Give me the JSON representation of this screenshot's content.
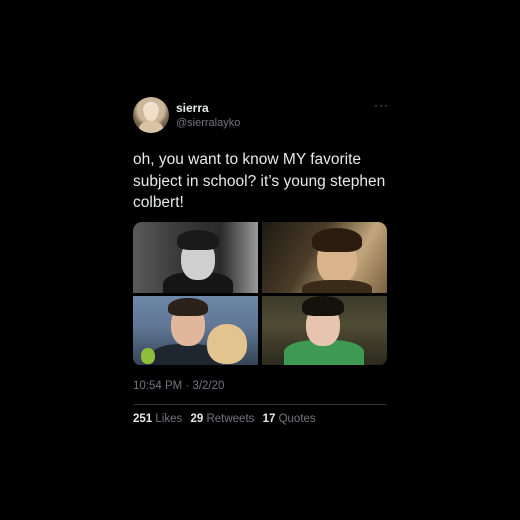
{
  "tweet": {
    "user": {
      "name": "sierra",
      "handle": "@sierralayko"
    },
    "more_label": "···",
    "text_lines": [
      "oh, you want to know MY favorite",
      "subject in school? it’s young stephen",
      "colbert!"
    ],
    "timestamp": "10:54 PM · 3/2/20",
    "stats": {
      "likes_count": "251",
      "likes_label": "Likes",
      "retweets_count": "29",
      "retweets_label": "Retweets",
      "quotes_count": "17",
      "quotes_label": "Quotes"
    }
  }
}
